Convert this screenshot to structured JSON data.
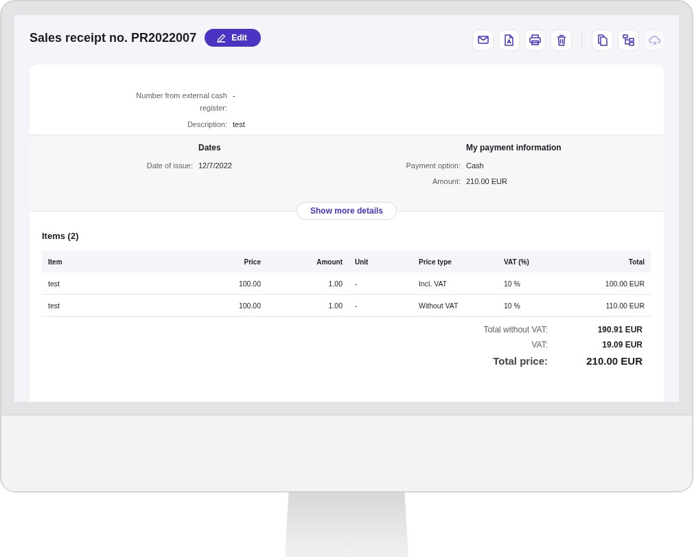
{
  "header": {
    "title": "Sales receipt no. PR2022007",
    "edit_button": "Edit"
  },
  "toolbar": [
    {
      "kind": "mail",
      "disabled": false
    },
    {
      "kind": "pdf",
      "disabled": false
    },
    {
      "kind": "print",
      "disabled": false
    },
    {
      "kind": "trash",
      "disabled": false
    },
    {
      "kind": "separator"
    },
    {
      "kind": "copy",
      "disabled": false
    },
    {
      "kind": "structure",
      "disabled": false
    },
    {
      "kind": "cloud",
      "disabled": true
    }
  ],
  "details": [
    {
      "label": "Number from external cash register:",
      "value": "-"
    },
    {
      "label": "Description:",
      "value": "test"
    }
  ],
  "dates": {
    "heading": "Dates",
    "fields": [
      {
        "label": "Date of issue:",
        "value": "12/7/2022"
      }
    ]
  },
  "payment": {
    "heading": "My payment information",
    "fields": [
      {
        "label": "Payment option:",
        "value": "Cash"
      },
      {
        "label": "Amount:",
        "value": "210.00 EUR"
      }
    ]
  },
  "show_more_button": "Show more details",
  "items": {
    "heading": "Items (2)",
    "columns": [
      "Item",
      "Price",
      "Amount",
      "Unit",
      "Price type",
      "VAT (%)",
      "Total"
    ],
    "rows": [
      [
        "test",
        "100.00",
        "1.00",
        "-",
        "Incl. VAT",
        "10 %",
        "100.00 EUR"
      ],
      [
        "test",
        "100.00",
        "1.00",
        "-",
        "Without VAT",
        "10 %",
        "110.00 EUR"
      ]
    ]
  },
  "totals": [
    {
      "kind": "normal",
      "label": "Total without VAT:",
      "value": "190.91 EUR"
    },
    {
      "kind": "normal",
      "label": "VAT:",
      "value": "19.09 EUR"
    },
    {
      "kind": "grand",
      "label": "Total price:",
      "value": "210.00 EUR"
    }
  ]
}
